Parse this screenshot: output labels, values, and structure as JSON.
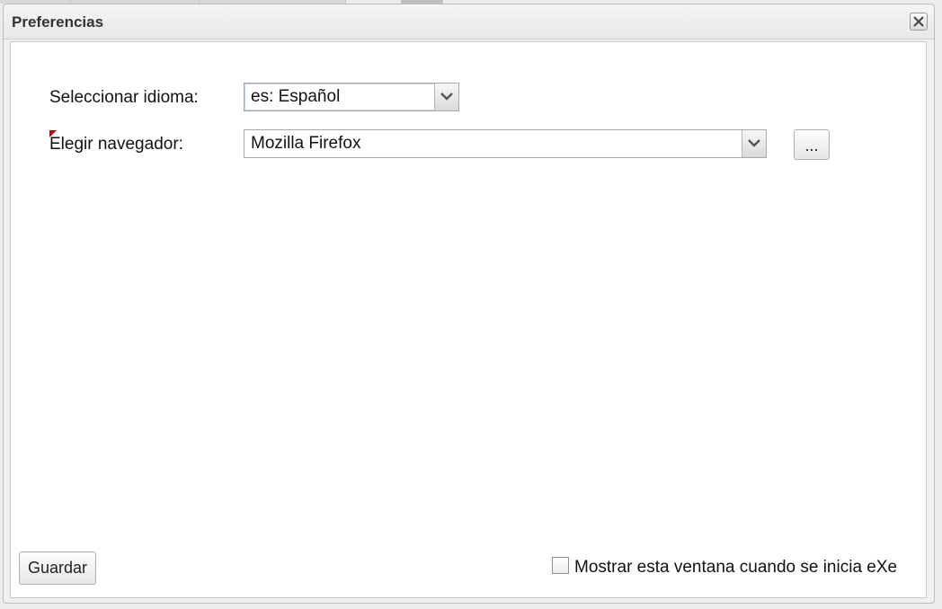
{
  "dialog": {
    "title": "Preferencias",
    "close_icon": "close-icon"
  },
  "form": {
    "language": {
      "label": "Seleccionar idioma:",
      "value": "es: Español"
    },
    "browser": {
      "label": "Elegir navegador:",
      "value": "Mozilla Firefox",
      "browse_label": "..."
    }
  },
  "footer": {
    "save_label": "Guardar",
    "show_on_start_label": "Mostrar esta ventana cuando se inicia eXe",
    "show_on_start_checked": false
  },
  "colors": {
    "required_marker": "#cc0000",
    "border": "#a8a8a8"
  }
}
